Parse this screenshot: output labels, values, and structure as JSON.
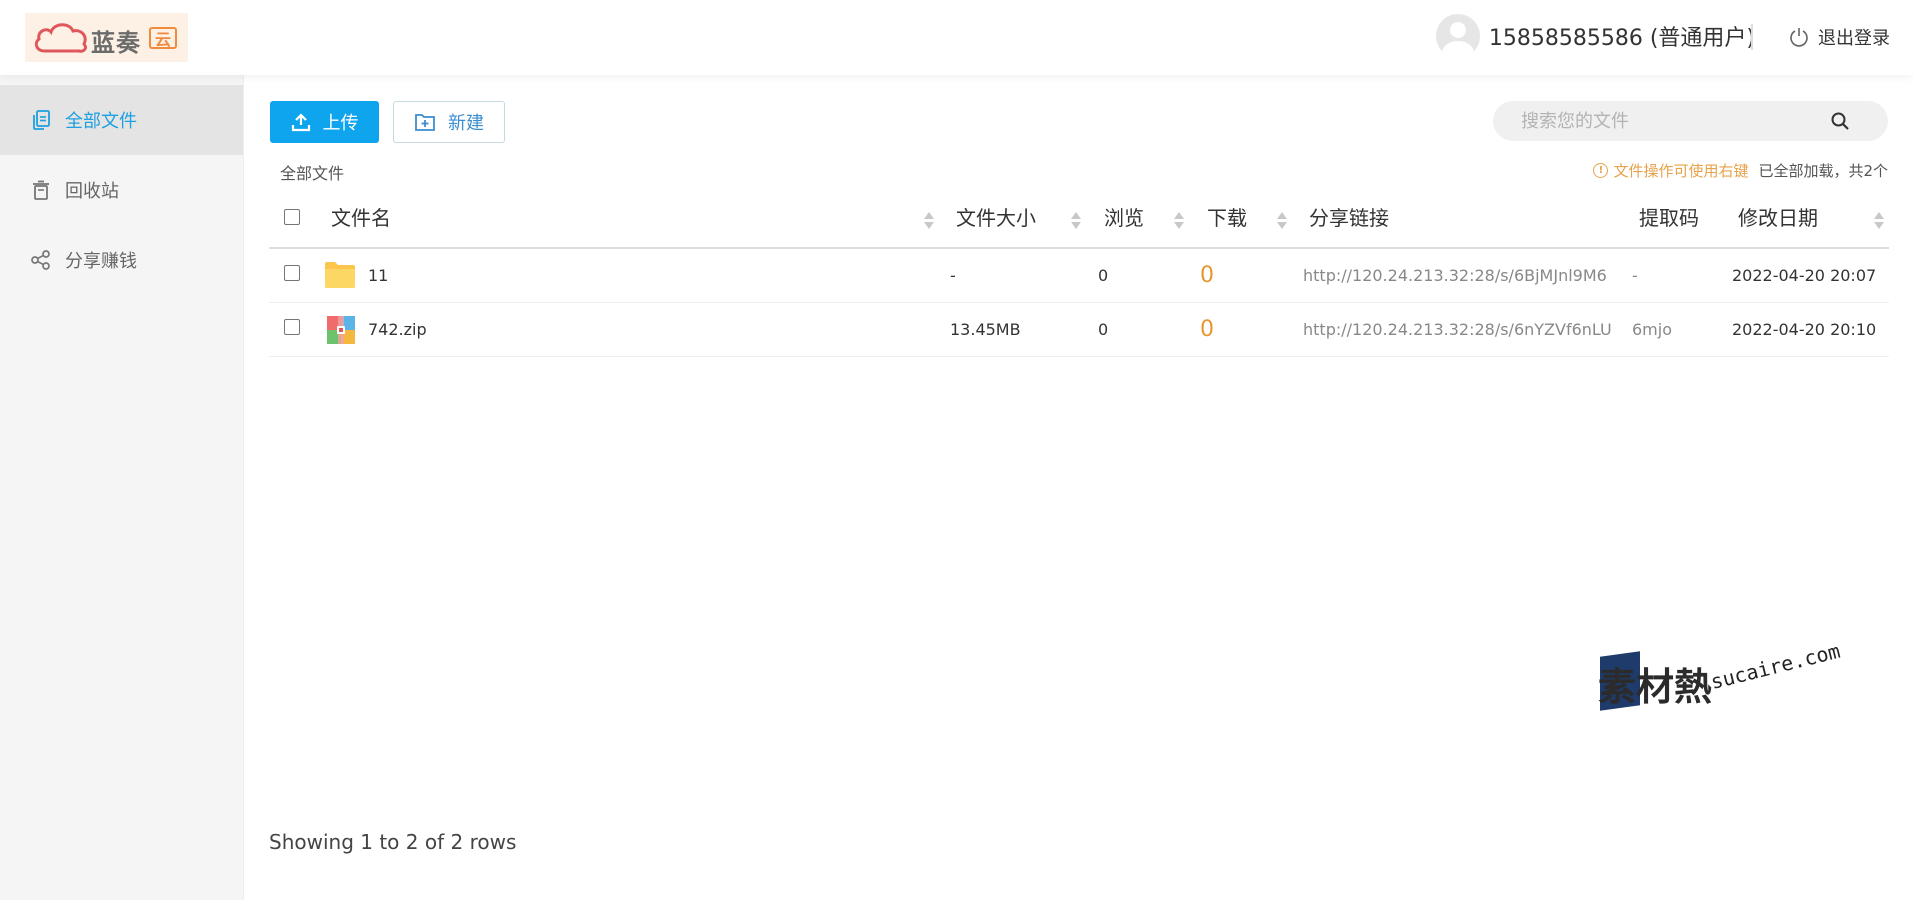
{
  "header": {
    "logo_text": "蓝奏",
    "logo_badge": "云",
    "username": "15858585586 (普通用户)",
    "logout_label": "退出登录"
  },
  "sidebar": {
    "items": [
      {
        "label": "全部文件",
        "icon": "files-icon",
        "active": true
      },
      {
        "label": "回收站",
        "icon": "trash-icon",
        "active": false
      },
      {
        "label": "分享赚钱",
        "icon": "share-icon",
        "active": false
      }
    ]
  },
  "toolbar": {
    "upload_label": "上传",
    "new_label": "新建",
    "search_placeholder": "搜索您的文件"
  },
  "breadcrumb": "全部文件",
  "tip": {
    "warning": "文件操作可使用右键",
    "loaded": "已全部加载，共2个"
  },
  "table": {
    "columns": {
      "name": "文件名",
      "size": "文件大小",
      "views": "浏览",
      "downloads": "下载",
      "share_link": "分享链接",
      "code": "提取码",
      "date": "修改日期"
    },
    "rows": [
      {
        "name": "11",
        "type": "folder-icon",
        "size": "-",
        "views": "0",
        "downloads": "0",
        "link": "http://120.24.213.32:28/s/6BjMJnl9M6",
        "code": "-",
        "date": "2022-04-20 20:07"
      },
      {
        "name": "742.zip",
        "type": "zip-icon",
        "size": "13.45MB",
        "views": "0",
        "downloads": "0",
        "link": "http://120.24.213.32:28/s/6nYZVf6nLU",
        "code": "6mjo",
        "date": "2022-04-20 20:10"
      }
    ]
  },
  "pager": "Showing 1 to 2 of 2 rows",
  "watermark": {
    "zh": "素材熱",
    "en": "sucaire.com"
  },
  "colors": {
    "primary": "#0ea5ee",
    "active_text": "#1e9fe0",
    "download_count": "#e89631",
    "warning": "#e8a24a"
  }
}
